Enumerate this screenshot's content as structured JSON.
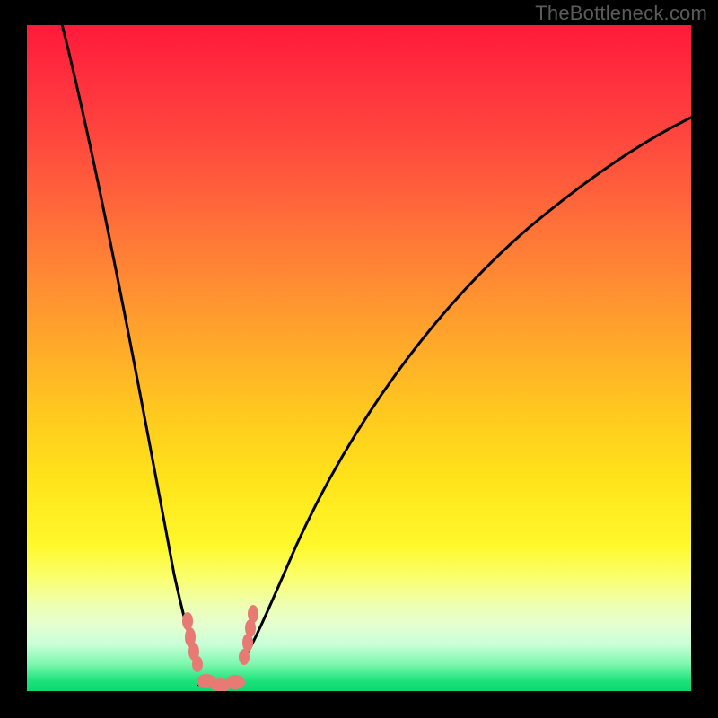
{
  "watermark": "TheBottleneck.com",
  "chart_data": {
    "type": "line",
    "title": "",
    "xlabel": "",
    "ylabel": "",
    "xlim": [
      0,
      100
    ],
    "ylim": [
      0,
      100
    ],
    "grid": false,
    "legend": null,
    "background": "vertical heat gradient (red top → green bottom) encoding bottleneck severity by y-value",
    "series": [
      {
        "name": "bottleneck-curve",
        "x": [
          5,
          10,
          15,
          20,
          23,
          25,
          27,
          29,
          31,
          33,
          36,
          42,
          50,
          60,
          72,
          85,
          100
        ],
        "values": [
          100,
          78,
          55,
          32,
          14,
          5,
          1,
          0,
          0,
          1,
          6,
          20,
          40,
          58,
          72,
          82,
          87
        ]
      }
    ],
    "annotations": [
      {
        "text": "optimal-range-markers",
        "x_range": [
          23,
          33
        ],
        "y_approx": 2
      }
    ],
    "notes": "No axis tick labels or numeric annotations are visible; x/y are normalized 0–100. The curve minimum (≈0) lies roughly at x≈27–31% from the left edge. Pink blobs mark the low-bottleneck region near the valley floor."
  }
}
